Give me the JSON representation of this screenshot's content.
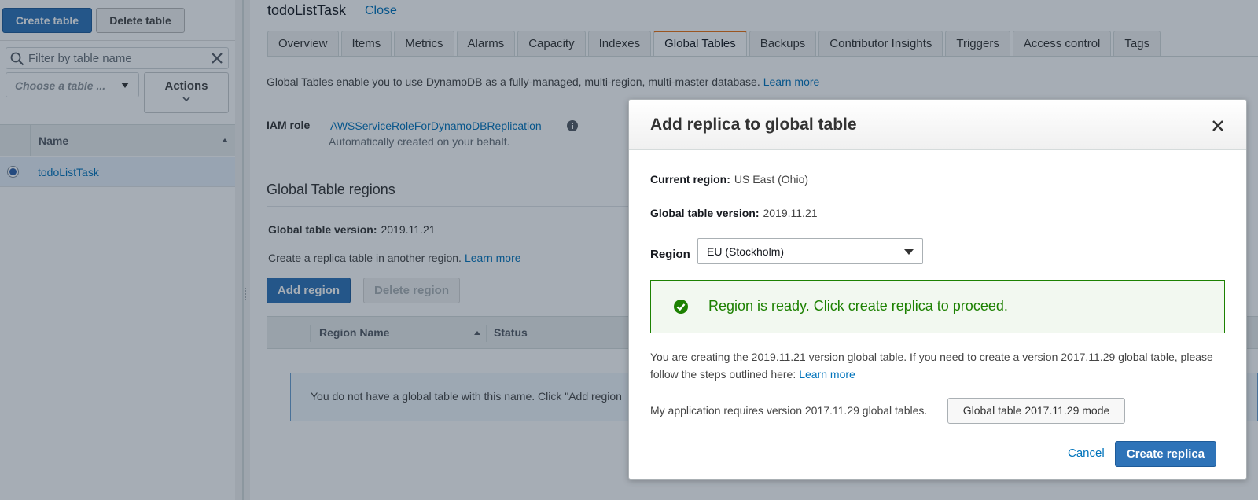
{
  "left": {
    "create_table": "Create table",
    "delete_table": "Delete table",
    "filter_placeholder": "Filter by table name",
    "choose_table": "Choose a table ...",
    "actions": "Actions",
    "table": {
      "header_name": "Name",
      "rows": [
        {
          "name": "todoListTask",
          "selected": true
        }
      ]
    }
  },
  "main": {
    "title": "todoListTask",
    "close": "Close",
    "tabs": [
      {
        "label": "Overview",
        "active": false
      },
      {
        "label": "Items",
        "active": false
      },
      {
        "label": "Metrics",
        "active": false
      },
      {
        "label": "Alarms",
        "active": false
      },
      {
        "label": "Capacity",
        "active": false
      },
      {
        "label": "Indexes",
        "active": false
      },
      {
        "label": "Global Tables",
        "active": true
      },
      {
        "label": "Backups",
        "active": false
      },
      {
        "label": "Contributor Insights",
        "active": false
      },
      {
        "label": "Triggers",
        "active": false
      },
      {
        "label": "Access control",
        "active": false
      },
      {
        "label": "Tags",
        "active": false
      }
    ],
    "intro_text": "Global Tables enable you to use DynamoDB as a fully-managed, multi-region, multi-master database.",
    "intro_learn_more": "Learn more",
    "iam_label": "IAM role",
    "iam_role": "AWSServiceRoleForDynamoDBReplication",
    "iam_sub": "Automatically created on your behalf.",
    "regions_title": "Global Table regions",
    "gtv_label": "Global table version:",
    "gtv_value": "2019.11.21",
    "create_text": "Create a replica table in another region.",
    "create_learn_more": "Learn more",
    "add_region": "Add region",
    "delete_region": "Delete region",
    "region_table": {
      "col_region_name": "Region Name",
      "col_status": "Status"
    },
    "empty_text": "You do not have a global table with this name. Click \"Add region"
  },
  "modal": {
    "title": "Add replica to global table",
    "current_region_label": "Current region:",
    "current_region_value": "US East (Ohio)",
    "gtv_label": "Global table version:",
    "gtv_value": "2019.11.21",
    "region_label": "Region",
    "region_selected": "EU (Stockholm)",
    "success_message": "Region is ready. Click create replica to proceed.",
    "note_text": "You are creating the 2019.11.21 version global table. If you need to create a version 2017.11.29 global table, please follow the steps outlined here:",
    "note_learn_more": "Learn more",
    "mode_text": "My application requires version 2017.11.29 global tables.",
    "mode_button": "Global table 2017.11.29 mode",
    "cancel": "Cancel",
    "create_replica": "Create replica"
  },
  "colors": {
    "primary_button": "#2e73b8",
    "link": "#0073bb",
    "success": "#1d8102",
    "active_tab_accent": "#ec7211"
  }
}
